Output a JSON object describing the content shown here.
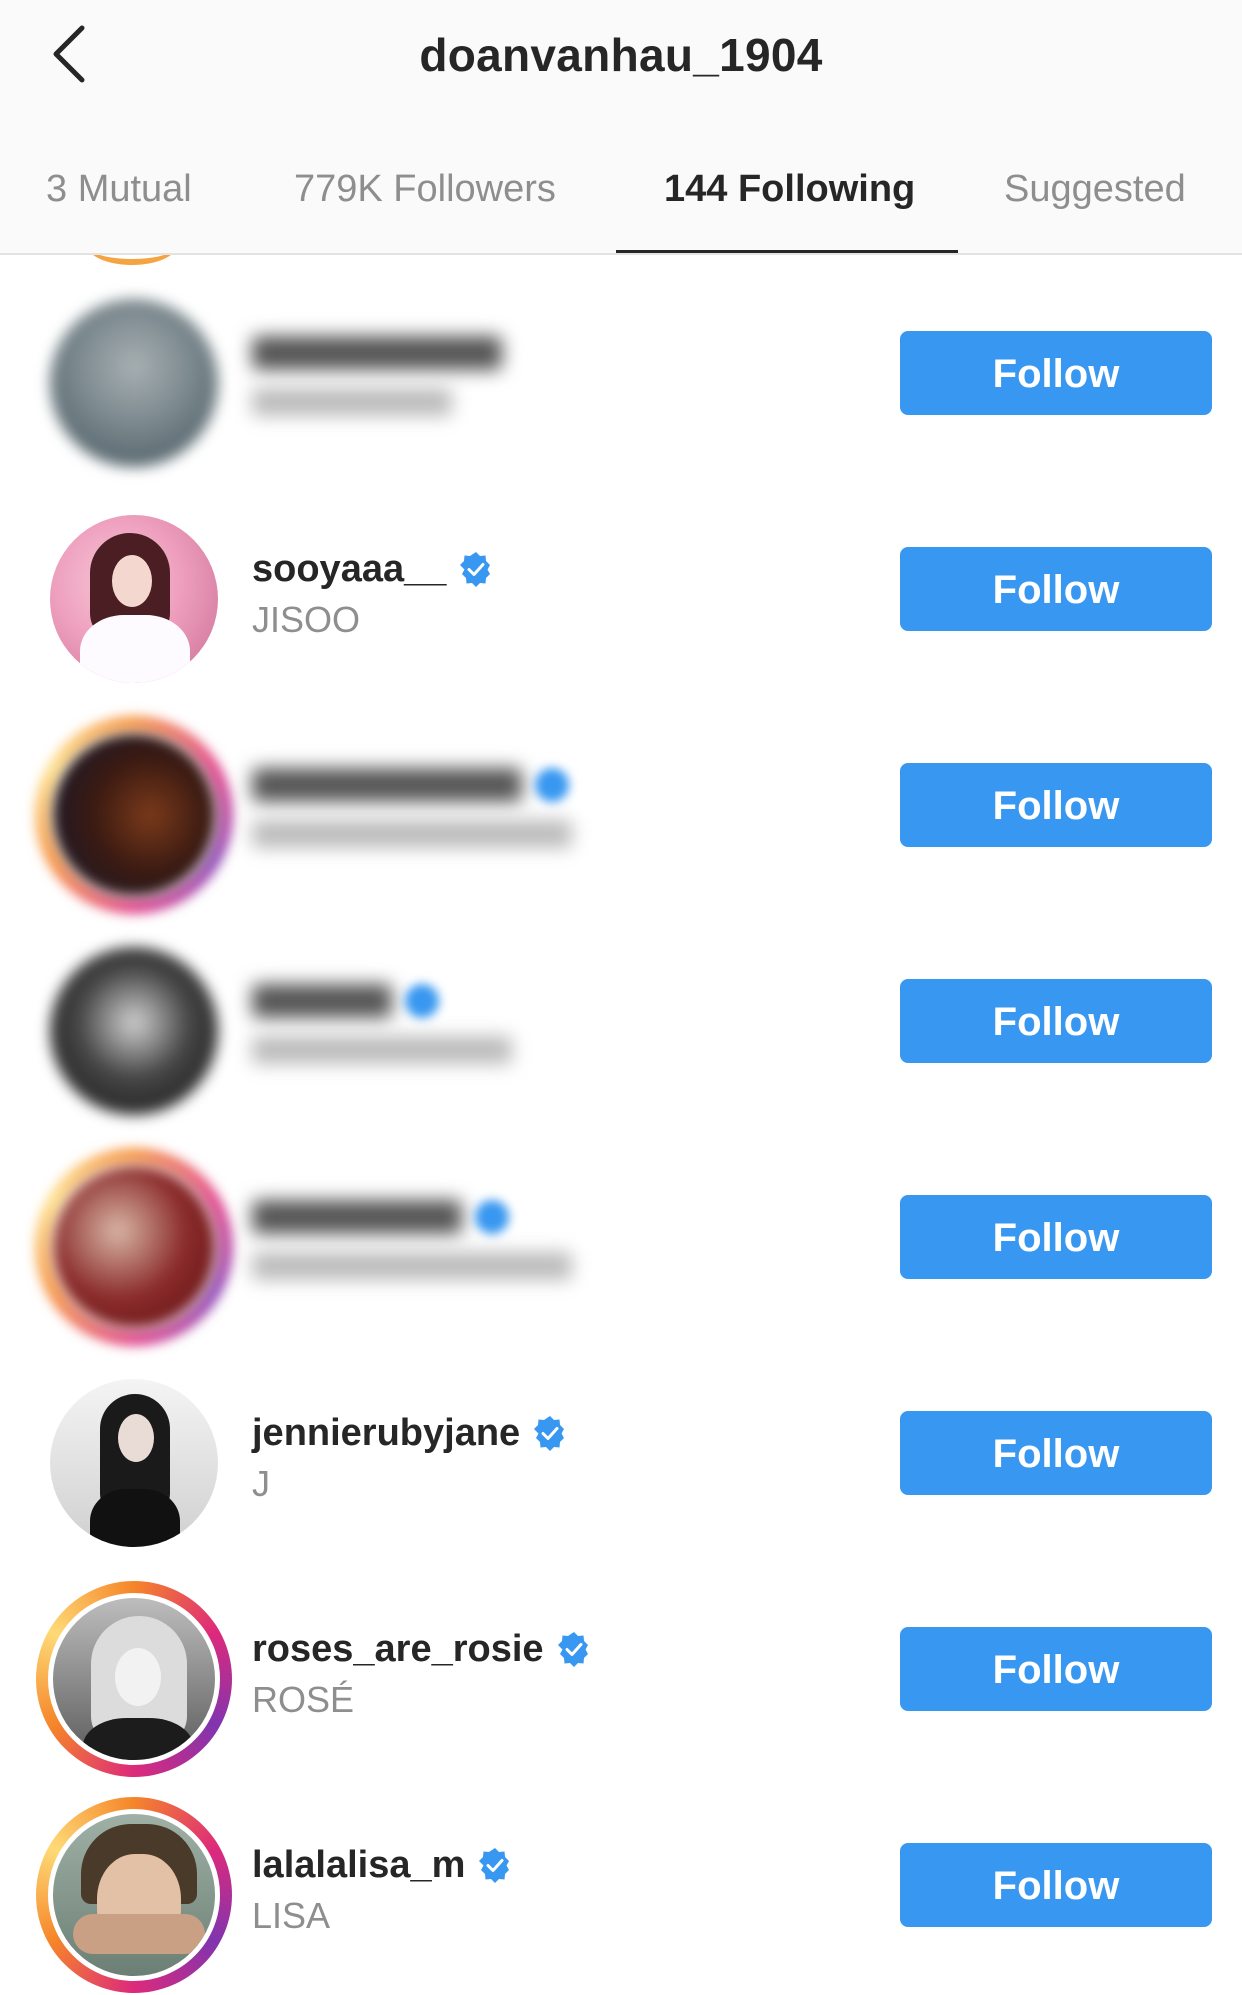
{
  "header": {
    "title": "doanvanhau_1904",
    "back_icon": "chevron-left-icon"
  },
  "tabs": [
    {
      "label": "3 Mutual",
      "active": false
    },
    {
      "label": "779K Followers",
      "active": false
    },
    {
      "label": "144 Following",
      "active": true
    },
    {
      "label": "Suggested",
      "active": false
    }
  ],
  "colors": {
    "follow_button": "#3897f0",
    "verified_badge": "#3897f0",
    "story_ring": "#dd2a7b"
  },
  "rows": [
    {
      "username": "",
      "fullname": "",
      "verified": false,
      "blurred": true,
      "button": "Follow"
    },
    {
      "username": "sooyaaa__",
      "fullname": "JISOO",
      "verified": true,
      "blurred": false,
      "button": "Follow"
    },
    {
      "username": "",
      "fullname": "",
      "verified": true,
      "blurred": true,
      "button": "Follow"
    },
    {
      "username": "",
      "fullname": "",
      "verified": true,
      "blurred": true,
      "button": "Follow"
    },
    {
      "username": "",
      "fullname": "",
      "verified": true,
      "blurred": true,
      "button": "Follow"
    },
    {
      "username": "jennierubyjane",
      "fullname": "J",
      "verified": true,
      "blurred": false,
      "button": "Follow"
    },
    {
      "username": "roses_are_rosie",
      "fullname": "ROSÉ",
      "verified": true,
      "blurred": false,
      "button": "Follow"
    },
    {
      "username": "lalalalisa_m",
      "fullname": "LISA",
      "verified": true,
      "blurred": false,
      "button": "Follow"
    }
  ]
}
